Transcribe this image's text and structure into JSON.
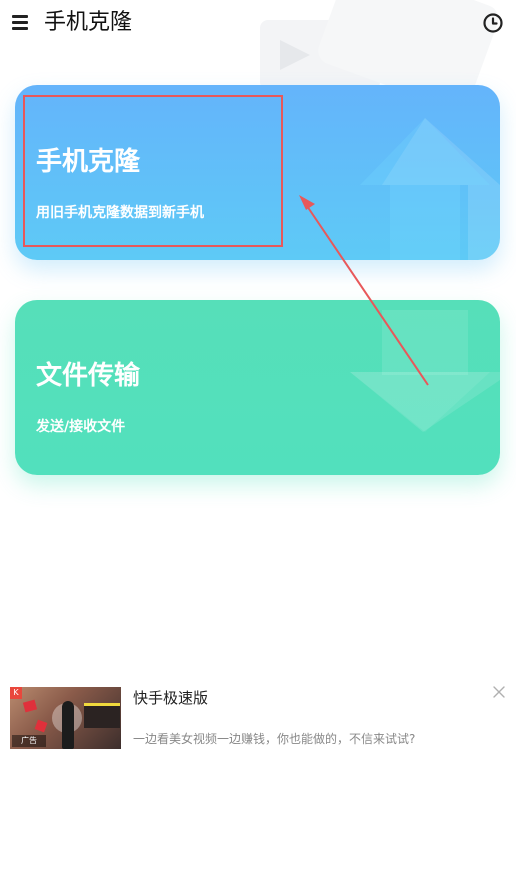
{
  "header": {
    "title": "手机克隆",
    "menu_icon": "menu-icon",
    "history_icon": "clock-history-icon"
  },
  "cards": [
    {
      "title": "手机克隆",
      "subtitle": "用旧手机克隆数据到新手机",
      "icon": "arrow-up-icon",
      "color": "#64b4fb"
    },
    {
      "title": "文件传输",
      "subtitle": "发送/接收文件",
      "icon": "arrow-down-icon",
      "color": "#52e0bd"
    }
  ],
  "ad": {
    "title": "快手极速版",
    "description": "一边看美女视频一边赚钱，你也能做的，不信来试试?",
    "badge": "广告",
    "close_icon": "close-icon"
  },
  "annotation": {
    "box_color": "#e8585a",
    "arrow_color": "#e8585a"
  }
}
